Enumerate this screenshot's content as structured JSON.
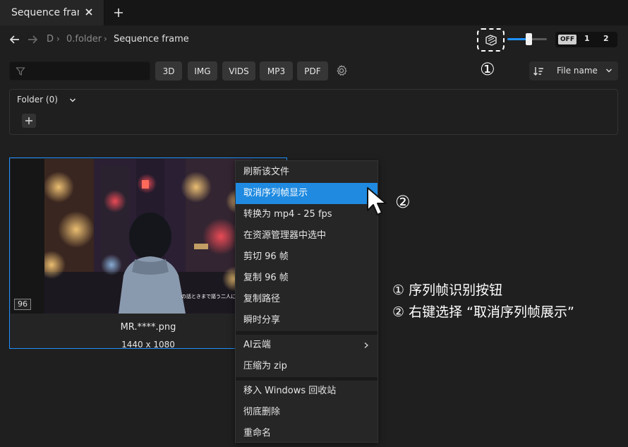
{
  "tab": {
    "title": "Sequence frame",
    "add_label": "+"
  },
  "breadcrumb": {
    "items": [
      "D",
      "0.folder",
      "Sequence frame"
    ]
  },
  "view_mode": {
    "slider_level": 0.55,
    "off_label": "OFF",
    "option_1": "1",
    "option_2": "2"
  },
  "filter": {
    "search_value": "",
    "search_placeholder": "",
    "buttons": [
      "3D",
      "IMG",
      "VIDS",
      "MP3",
      "PDF"
    ],
    "sort_label": "File name"
  },
  "folder": {
    "label": "Folder (0)"
  },
  "card": {
    "frame_count": "96",
    "file_name": "MR.****.png",
    "dimensions": "1440 x 1080",
    "subtitle_text": "の話ときまで謳う二人に"
  },
  "context_menu": {
    "groups": [
      [
        "刷新该文件",
        "取消序列帧显示",
        "转换为 mp4 - 25 fps",
        "在资源管理器中选中",
        "剪切 96 帧",
        "复制 96 帧",
        "复制路径",
        "瞬时分享"
      ],
      [
        "AI云端",
        "压缩为 zip"
      ],
      [
        "移入 Windows 回收站",
        "彻底删除",
        "重命名"
      ]
    ],
    "active_item": "取消序列帧显示"
  },
  "annotations": {
    "marker_1": "①",
    "marker_2": "②",
    "note_1": "① 序列帧识别按钮",
    "note_2": "② 右键选择 “取消序列帧展示”"
  },
  "colors": {
    "accent": "#1e8fff",
    "menu_highlight": "#1f8ae0",
    "background": "#1f1f1f",
    "panel": "#262626",
    "button": "#363636"
  },
  "icons": {
    "tab_close": "close-icon",
    "tab_add": "plus-icon",
    "back": "arrow-left-icon",
    "forward": "arrow-right-icon",
    "sequence": "sequence-frame-icon",
    "filter": "filter-icon",
    "settings": "gear-icon",
    "sort": "sort-icon",
    "dropdown": "chevron-down-icon",
    "submenu": "chevron-right-icon",
    "cursor": "mouse-pointer-icon"
  }
}
